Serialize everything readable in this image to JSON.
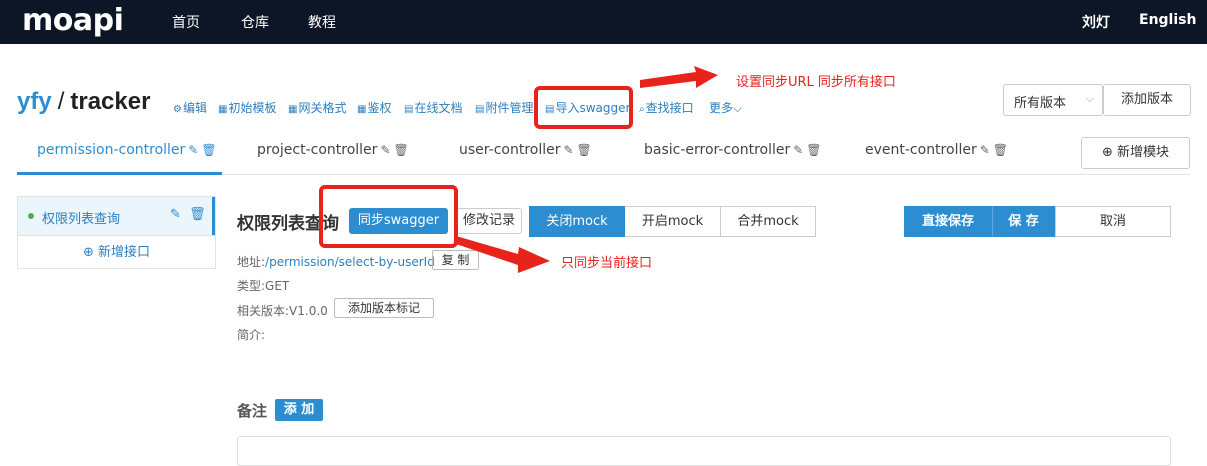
{
  "topnav": {
    "logo": "moapi",
    "links": [
      "首页",
      "仓库",
      "教程"
    ],
    "user": "刘灯",
    "language": "English"
  },
  "project": {
    "owner": "yfy",
    "separator": "/",
    "name": "tracker",
    "tools": [
      {
        "icon": "⚙",
        "label": "编辑"
      },
      {
        "icon": "▦",
        "label": "初始模板"
      },
      {
        "icon": "▦",
        "label": "网关格式"
      },
      {
        "icon": "▦",
        "label": "鉴权"
      },
      {
        "icon": "▤",
        "label": "在线文档"
      },
      {
        "icon": "▤",
        "label": "附件管理"
      },
      {
        "icon": "▤",
        "label": "导入swagger"
      },
      {
        "icon": "⌕",
        "label": "查找接口"
      }
    ],
    "more": "更多",
    "version_select": "所有版本",
    "add_version": "添加版本"
  },
  "tabs": [
    {
      "label": "permission-controller",
      "active": true
    },
    {
      "label": "project-controller",
      "active": false
    },
    {
      "label": "user-controller",
      "active": false
    },
    {
      "label": "basic-error-controller",
      "active": false
    },
    {
      "label": "event-controller",
      "active": false
    }
  ],
  "add_module": "新增模块",
  "sidebar": {
    "items": [
      {
        "label": "权限列表查询"
      }
    ],
    "add_api": "新增接口"
  },
  "api": {
    "title": "权限列表查询",
    "sync_button": "同步swagger",
    "history_button": "修改记录",
    "mock_buttons": [
      "关闭mock",
      "开启mock",
      "合并mock"
    ],
    "save_direct": "直接保存",
    "save": "保 存",
    "cancel": "取消",
    "address_label": "地址:",
    "address": "/permission/select-by-userId",
    "copy": "复 制",
    "type_label": "类型:",
    "type": "GET",
    "version_label": "相关版本:",
    "version": "V1.0.0",
    "add_version_mark": "添加版本标记",
    "intro_label": "简介:"
  },
  "notes": {
    "label": "备注",
    "add": "添 加"
  },
  "annotations": {
    "top": "设置同步URL  同步所有接口",
    "bottom": "只同步当前接口",
    "color": "#e8231c"
  }
}
